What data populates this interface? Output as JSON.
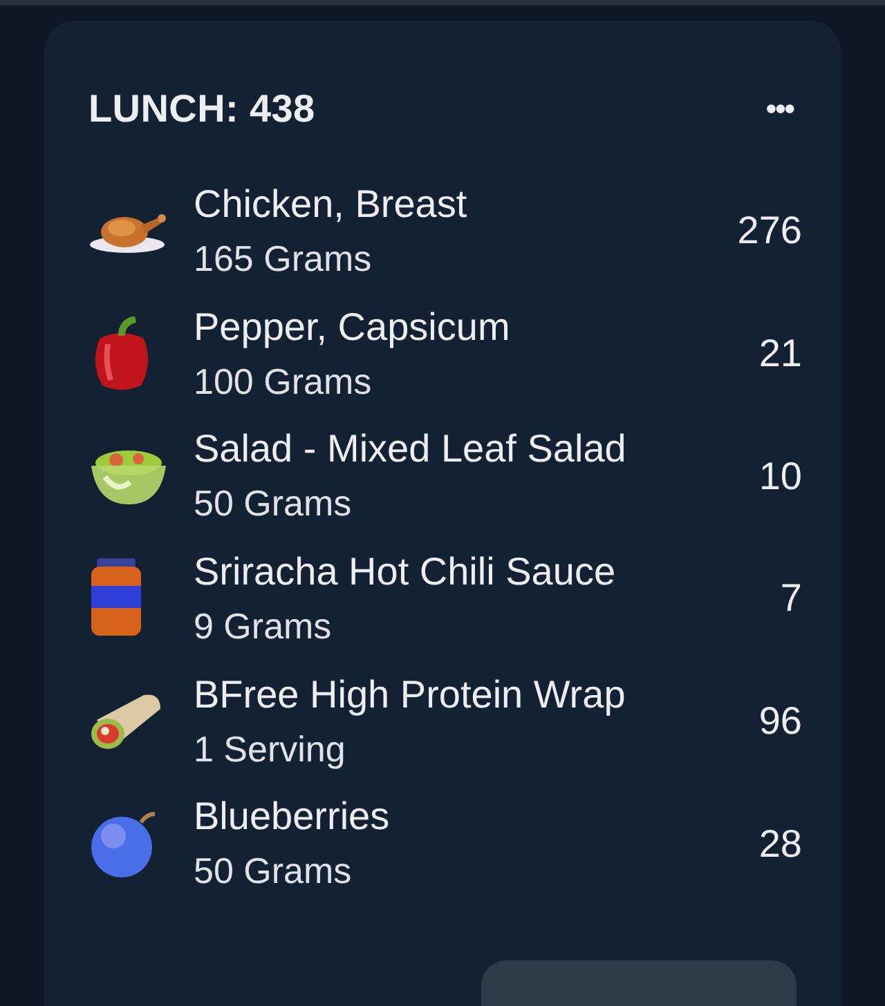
{
  "meal": {
    "title": "LUNCH: 438",
    "menu": "•••"
  },
  "foods": [
    {
      "kind": "chicken",
      "name": "Chicken, Breast",
      "amount": "165 Grams",
      "calories": "276"
    },
    {
      "kind": "pepper",
      "name": "Pepper, Capsicum",
      "amount": "100 Grams",
      "calories": "21"
    },
    {
      "kind": "salad",
      "name": "Salad - Mixed Leaf Salad",
      "amount": "50 Grams",
      "calories": "10"
    },
    {
      "kind": "sauce",
      "name": "Sriracha Hot Chili Sauce",
      "amount": "9 Grams",
      "calories": "7"
    },
    {
      "kind": "wrap",
      "name": "BFree High Protein Wrap",
      "amount": "1 Serving",
      "calories": "96"
    },
    {
      "kind": "berry",
      "name": "Blueberries",
      "amount": "50 Grams",
      "calories": "28"
    }
  ]
}
